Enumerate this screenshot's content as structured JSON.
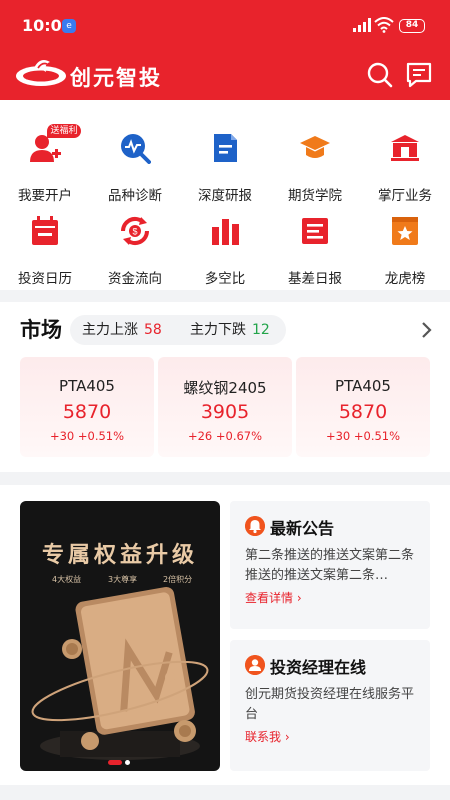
{
  "status_bar": {
    "time": "10:01",
    "battery": "84"
  },
  "header": {
    "brand": "创元智投",
    "search_icon": "search-icon",
    "message_icon": "message-icon"
  },
  "menu": {
    "badge": "送福利",
    "items": [
      {
        "label": "我要开户",
        "icon": "add-user-icon"
      },
      {
        "label": "品种诊断",
        "icon": "diagnosis-icon"
      },
      {
        "label": "深度研报",
        "icon": "report-icon"
      },
      {
        "label": "期货学院",
        "icon": "graduation-icon"
      },
      {
        "label": "掌厅业务",
        "icon": "bank-icon"
      },
      {
        "label": "投资日历",
        "icon": "calendar-icon"
      },
      {
        "label": "资金流向",
        "icon": "money-flow-icon"
      },
      {
        "label": "多空比",
        "icon": "bar-chart-icon"
      },
      {
        "label": "基差日报",
        "icon": "daily-report-icon"
      },
      {
        "label": "龙虎榜",
        "icon": "ranking-icon"
      }
    ]
  },
  "market": {
    "title": "市场",
    "main_up_label": "主力上涨",
    "main_up_count": "58",
    "main_down_label": "主力下跌",
    "main_down_count": "12",
    "cards": [
      {
        "name": "PTA405",
        "price": "5870",
        "change": "+30 +0.51%"
      },
      {
        "name": "螺纹钢2405",
        "price": "3905",
        "change": "+26 +0.67%"
      },
      {
        "name": "PTA405",
        "price": "5870",
        "change": "+30 +0.51%"
      }
    ]
  },
  "banner": {
    "title": "专属权益升级",
    "features": [
      "4大权益",
      "3大尊享",
      "2倍积分"
    ]
  },
  "announcement": {
    "title": "最新公告",
    "desc": "第二条推送的推送文案第二条推送的推送文案第二条…",
    "link": "查看详情"
  },
  "manager": {
    "title": "投资经理在线",
    "desc": "创元期货投资经理在线服务平台",
    "link": "联系我"
  },
  "colors": {
    "brand_red": "#e8232c",
    "rise": "#e8232c",
    "fall": "#22a44a",
    "blue": "#1e62c8",
    "orange": "#f0541e"
  }
}
